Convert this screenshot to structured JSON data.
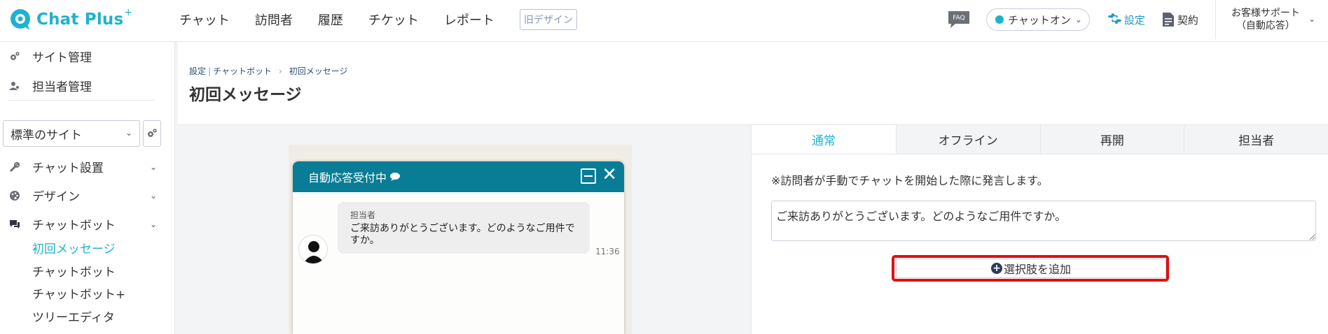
{
  "header": {
    "logo_text": "Chat Plus",
    "logo_sup": "+",
    "nav": [
      "チャット",
      "訪問者",
      "履歴",
      "チケット",
      "レポート"
    ],
    "old_design": "旧デザイン",
    "faq": "FAQ",
    "chat_status": "チャットオン",
    "settings": "設定",
    "contract": "契約",
    "support_line1": "お客様サポート",
    "support_line2": "（自動応答）"
  },
  "sidebar": {
    "site_admin": "サイト管理",
    "staff_admin": "担当者管理",
    "site_select": "標準のサイト",
    "categories": [
      "チャット設置",
      "デザイン",
      "チャットボット"
    ],
    "sub_items": [
      "初回メッセージ",
      "チャットボット",
      "チャットボット+",
      "ツリーエディタ"
    ]
  },
  "main": {
    "breadcrumb": [
      "設定",
      "チャットボット",
      "初回メッセージ"
    ],
    "page_title": "初回メッセージ"
  },
  "widget": {
    "title": "自動応答受付中",
    "sender": "担当者",
    "message": "ご来訪ありがとうございます。どのようなご用件ですか。",
    "time": "11:36"
  },
  "editor": {
    "tabs": [
      "通常",
      "オフライン",
      "再開",
      "担当者"
    ],
    "note": "※訪問者が手動でチャットを開始した際に発言します。",
    "textarea_value": "ご来訪ありがとうございます。どのようなご用件ですか。",
    "add_choice": "選択肢を追加"
  },
  "colors": {
    "accent": "#1fb2cf",
    "widget_header": "#087d95",
    "highlight": "#e10f0f"
  }
}
